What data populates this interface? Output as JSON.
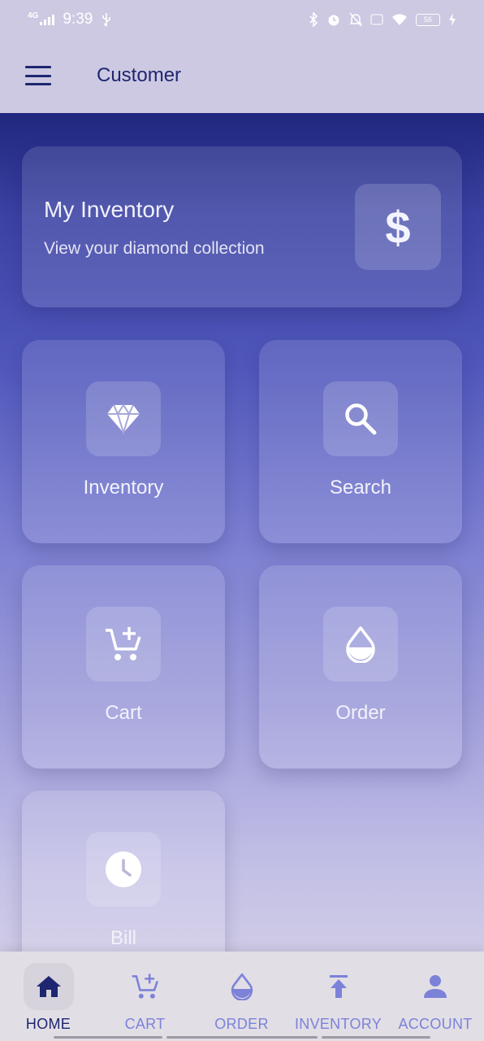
{
  "status_bar": {
    "network": "4G",
    "time": "9:39",
    "battery": "56"
  },
  "app_bar": {
    "title": "Customer"
  },
  "hero_card": {
    "title": "My Inventory",
    "subtitle": "View your diamond collection",
    "icon": "dollar-icon",
    "icon_glyph": "$"
  },
  "tiles": [
    {
      "label": "Inventory",
      "icon": "diamond-icon"
    },
    {
      "label": "Search",
      "icon": "search-icon"
    },
    {
      "label": "Cart",
      "icon": "add-cart-icon"
    },
    {
      "label": "Order",
      "icon": "drop-icon"
    },
    {
      "label": "Bill",
      "icon": "clock-icon"
    }
  ],
  "bottom_nav": {
    "items": [
      {
        "label": "HOME",
        "icon": "home-icon",
        "active": true
      },
      {
        "label": "CART",
        "icon": "add-cart-icon",
        "active": false
      },
      {
        "label": "ORDER",
        "icon": "drop-icon",
        "active": false
      },
      {
        "label": "INVENTORY",
        "icon": "upload-icon",
        "active": false
      },
      {
        "label": "ACCOUNT",
        "icon": "person-icon",
        "active": false
      }
    ]
  },
  "colors": {
    "primary": "#1e2670",
    "nav_inactive": "#7c82d8",
    "app_bar_bg": "#cdc9e2"
  }
}
